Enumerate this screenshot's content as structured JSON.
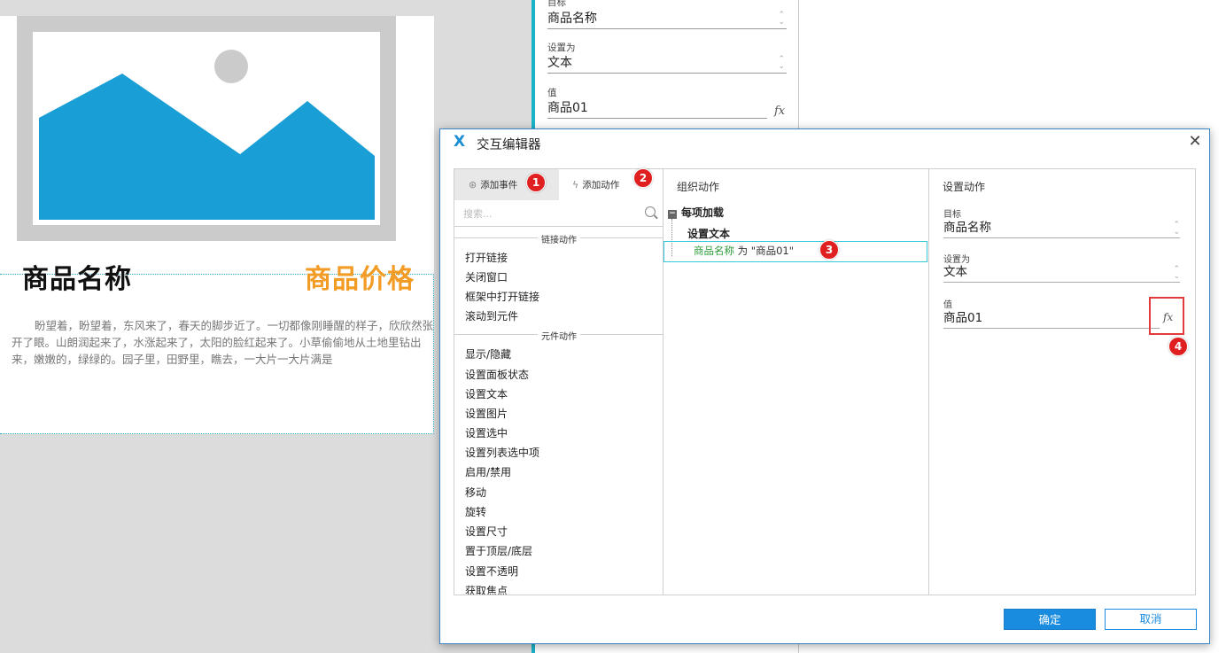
{
  "canvas": {
    "product_name": "商品名称",
    "product_price": "商品价格",
    "description": "盼望着，盼望着，东风来了，春天的脚步近了。一切都像刚睡醒的样子，欣欣然张开了眼。山朗润起来了，水涨起来了，太阳的脸红起来了。小草偷偷地从土地里钻出来，嫩嫩的，绿绿的。园子里，田野里，瞧去，一大片一大片满是",
    "image_icon": "image-placeholder-icon"
  },
  "background_panel": {
    "target_label": "目标",
    "target_value": "商品名称",
    "set_as_label": "设置为",
    "set_as_value": "文本",
    "value_label": "值",
    "value_value": "商品01",
    "fx": "fx"
  },
  "dialog": {
    "title": "交互编辑器",
    "logo": "X",
    "close": "✕",
    "tabs": {
      "add_event": "添加事件",
      "add_action": "添加动作"
    },
    "search_placeholder": "搜索...",
    "sections": [
      {
        "header": "链接动作",
        "items": [
          "打开链接",
          "关闭窗口",
          "框架中打开链接",
          "滚动到元件"
        ]
      },
      {
        "header": "元件动作",
        "items": [
          "显示/隐藏",
          "设置面板状态",
          "设置文本",
          "设置图片",
          "设置选中",
          "设置列表选中项",
          "启用/禁用",
          "移动",
          "旋转",
          "设置尺寸",
          "置于顶层/底层",
          "设置不透明",
          "获取焦点"
        ]
      }
    ],
    "organize": {
      "header": "组织动作",
      "event": "每项加载",
      "minus": "−",
      "action": "设置文本",
      "detail_target": "商品名称",
      "detail_rest": " 为 \"商品01\""
    },
    "settings": {
      "header": "设置动作",
      "target_label": "目标",
      "target_value": "商品名称",
      "set_as_label": "设置为",
      "set_as_value": "文本",
      "value_label": "值",
      "value_value": "商品01",
      "fx": "fx"
    },
    "buttons": {
      "ok": "确定",
      "cancel": "取消"
    },
    "arrows": "⌃⌄"
  },
  "badges": [
    "1",
    "2",
    "3",
    "4"
  ],
  "colors": {
    "accent": "#1a8ce0",
    "price": "#f39c25",
    "badge": "#e02020",
    "highlight": "#33c9d8",
    "target_green": "#2e9c3a"
  }
}
